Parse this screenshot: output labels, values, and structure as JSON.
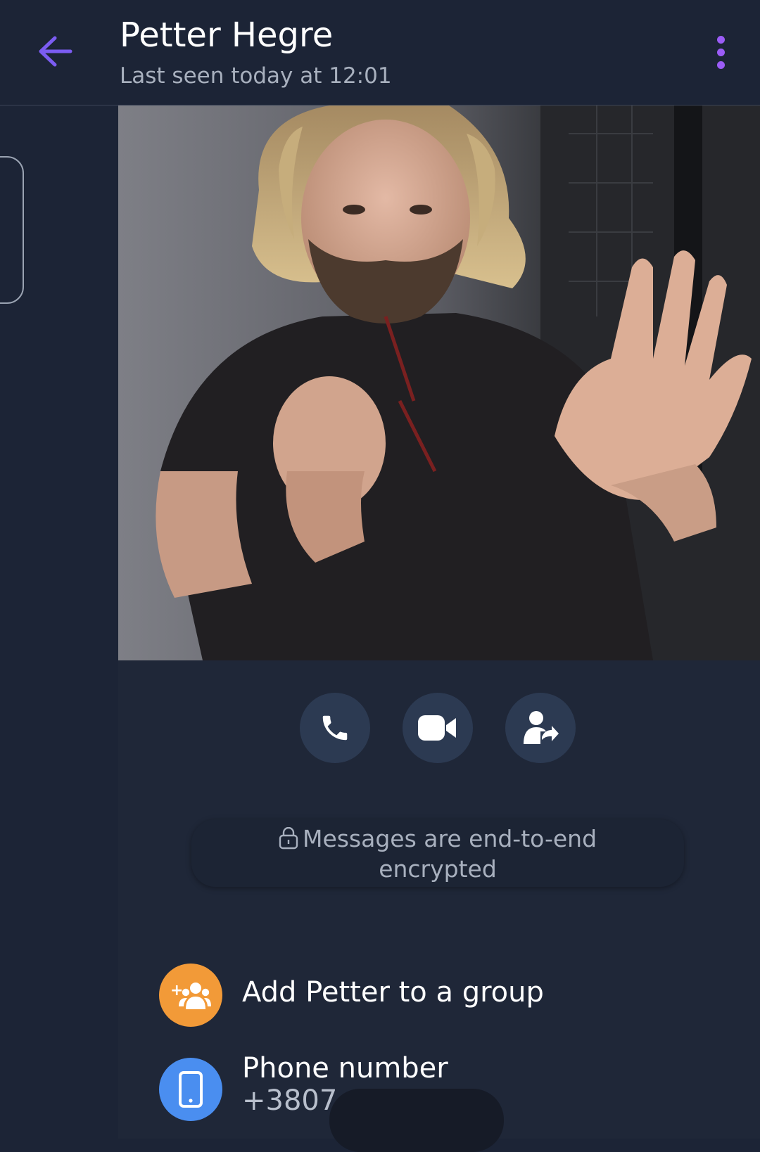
{
  "header": {
    "back_icon": "arrow-left-icon",
    "title": "Petter Hegre",
    "subtitle": "Last seen today at 12:01",
    "more_icon": "more-vertical-icon",
    "accent": "#9b5cf6"
  },
  "profile": {
    "photo": "contact-photo"
  },
  "actions": [
    {
      "icon": "phone-icon"
    },
    {
      "icon": "video-camera-icon"
    },
    {
      "icon": "share-contact-icon"
    }
  ],
  "encryption": {
    "icon": "lock-icon",
    "line1": "Messages are end-to-end",
    "line2": "encrypted"
  },
  "list": {
    "add_to_group": {
      "icon": "add-group-icon",
      "icon_color": "#f29a38",
      "label": "Add Petter to a group"
    },
    "phone": {
      "icon": "mobile-phone-icon",
      "icon_color": "#4a8ef0",
      "label": "Phone number",
      "value": "+3807"
    }
  }
}
